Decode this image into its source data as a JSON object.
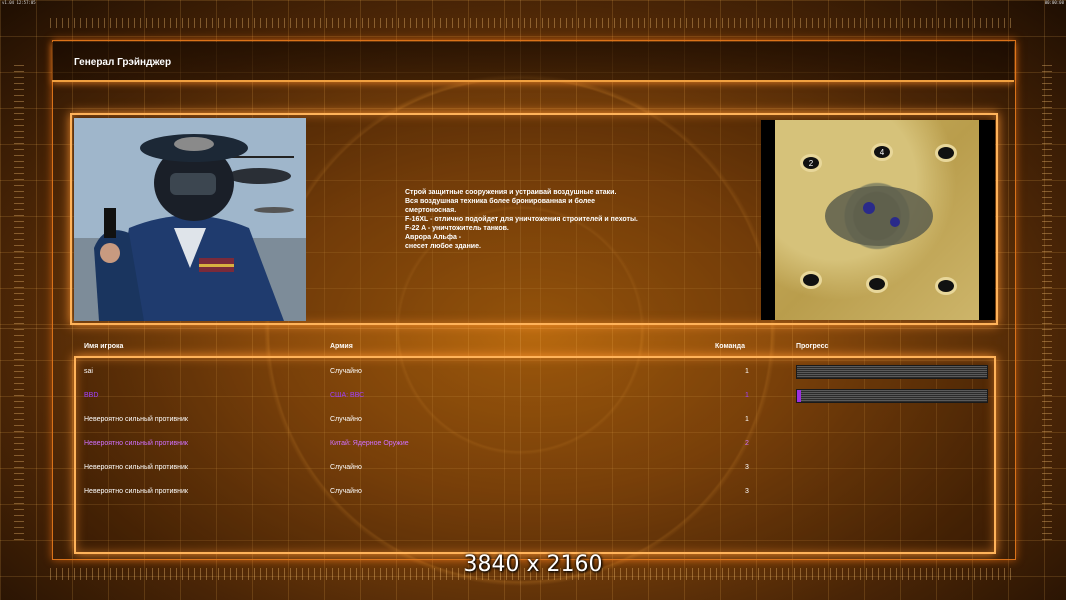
{
  "topbar": {
    "left": "v1.04  12:57:05",
    "right": "00:00:00"
  },
  "title": "Генерал Грэйнджер",
  "briefing": {
    "lines": [
      "Строй защитные сооружения и устраивай воздушные атаки.",
      "Вся воздушная техника более бронированная и более",
      "смертоносная.",
      "F-16XL - отлично подойдет для уничтожения строителей и пехоты.",
      "F-22 A - уничтожитель танков.",
      "Аврора Альфа -",
      "снесет любое здание."
    ]
  },
  "minimap": {
    "markers": [
      "2",
      "4",
      "",
      "",
      "",
      ""
    ]
  },
  "table": {
    "headers": {
      "name": "Имя игрока",
      "army": "Армия",
      "team": "Команда",
      "progress": "Прогресс"
    },
    "rows": [
      {
        "name": "sai",
        "army": "Случайно",
        "team": "1",
        "color": "#ffffff",
        "progress": 0
      },
      {
        "name": "BBD",
        "army": "США: ВВС",
        "team": "1",
        "color": "#a040ff",
        "progress": 0.02
      },
      {
        "name": "Невероятно сильный противник",
        "army": "Случайно",
        "team": "1",
        "color": "#ffffff"
      },
      {
        "name": "Невероятно сильный противник",
        "army": "Китай: Ядерное Оружие",
        "team": "2",
        "color": "#d070ff"
      },
      {
        "name": "Невероятно сильный противник",
        "army": "Случайно",
        "team": "3",
        "color": "#ffffff"
      },
      {
        "name": "Невероятно сильный противник",
        "army": "Случайно",
        "team": "3",
        "color": "#ffffff"
      }
    ]
  },
  "watermark": "3840 x 2160"
}
